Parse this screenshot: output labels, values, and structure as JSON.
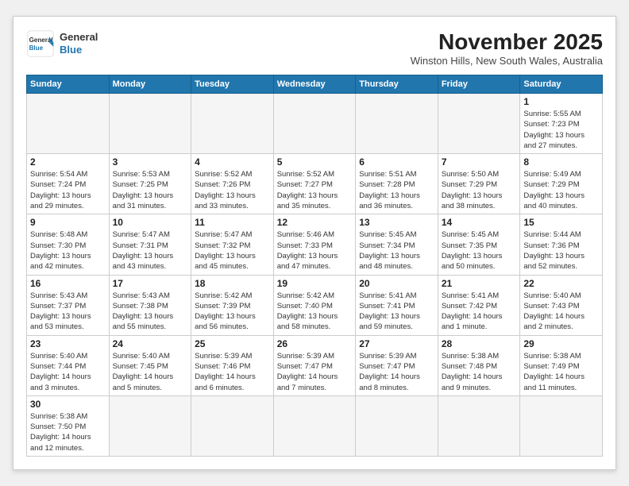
{
  "header": {
    "logo_general": "General",
    "logo_blue": "Blue",
    "month_title": "November 2025",
    "subtitle": "Winston Hills, New South Wales, Australia"
  },
  "days_of_week": [
    "Sunday",
    "Monday",
    "Tuesday",
    "Wednesday",
    "Thursday",
    "Friday",
    "Saturday"
  ],
  "weeks": [
    [
      {
        "day": "",
        "info": ""
      },
      {
        "day": "",
        "info": ""
      },
      {
        "day": "",
        "info": ""
      },
      {
        "day": "",
        "info": ""
      },
      {
        "day": "",
        "info": ""
      },
      {
        "day": "",
        "info": ""
      },
      {
        "day": "1",
        "info": "Sunrise: 5:55 AM\nSunset: 7:23 PM\nDaylight: 13 hours\nand 27 minutes."
      }
    ],
    [
      {
        "day": "2",
        "info": "Sunrise: 5:54 AM\nSunset: 7:24 PM\nDaylight: 13 hours\nand 29 minutes."
      },
      {
        "day": "3",
        "info": "Sunrise: 5:53 AM\nSunset: 7:25 PM\nDaylight: 13 hours\nand 31 minutes."
      },
      {
        "day": "4",
        "info": "Sunrise: 5:52 AM\nSunset: 7:26 PM\nDaylight: 13 hours\nand 33 minutes."
      },
      {
        "day": "5",
        "info": "Sunrise: 5:52 AM\nSunset: 7:27 PM\nDaylight: 13 hours\nand 35 minutes."
      },
      {
        "day": "6",
        "info": "Sunrise: 5:51 AM\nSunset: 7:28 PM\nDaylight: 13 hours\nand 36 minutes."
      },
      {
        "day": "7",
        "info": "Sunrise: 5:50 AM\nSunset: 7:29 PM\nDaylight: 13 hours\nand 38 minutes."
      },
      {
        "day": "8",
        "info": "Sunrise: 5:49 AM\nSunset: 7:29 PM\nDaylight: 13 hours\nand 40 minutes."
      }
    ],
    [
      {
        "day": "9",
        "info": "Sunrise: 5:48 AM\nSunset: 7:30 PM\nDaylight: 13 hours\nand 42 minutes."
      },
      {
        "day": "10",
        "info": "Sunrise: 5:47 AM\nSunset: 7:31 PM\nDaylight: 13 hours\nand 43 minutes."
      },
      {
        "day": "11",
        "info": "Sunrise: 5:47 AM\nSunset: 7:32 PM\nDaylight: 13 hours\nand 45 minutes."
      },
      {
        "day": "12",
        "info": "Sunrise: 5:46 AM\nSunset: 7:33 PM\nDaylight: 13 hours\nand 47 minutes."
      },
      {
        "day": "13",
        "info": "Sunrise: 5:45 AM\nSunset: 7:34 PM\nDaylight: 13 hours\nand 48 minutes."
      },
      {
        "day": "14",
        "info": "Sunrise: 5:45 AM\nSunset: 7:35 PM\nDaylight: 13 hours\nand 50 minutes."
      },
      {
        "day": "15",
        "info": "Sunrise: 5:44 AM\nSunset: 7:36 PM\nDaylight: 13 hours\nand 52 minutes."
      }
    ],
    [
      {
        "day": "16",
        "info": "Sunrise: 5:43 AM\nSunset: 7:37 PM\nDaylight: 13 hours\nand 53 minutes."
      },
      {
        "day": "17",
        "info": "Sunrise: 5:43 AM\nSunset: 7:38 PM\nDaylight: 13 hours\nand 55 minutes."
      },
      {
        "day": "18",
        "info": "Sunrise: 5:42 AM\nSunset: 7:39 PM\nDaylight: 13 hours\nand 56 minutes."
      },
      {
        "day": "19",
        "info": "Sunrise: 5:42 AM\nSunset: 7:40 PM\nDaylight: 13 hours\nand 58 minutes."
      },
      {
        "day": "20",
        "info": "Sunrise: 5:41 AM\nSunset: 7:41 PM\nDaylight: 13 hours\nand 59 minutes."
      },
      {
        "day": "21",
        "info": "Sunrise: 5:41 AM\nSunset: 7:42 PM\nDaylight: 14 hours\nand 1 minute."
      },
      {
        "day": "22",
        "info": "Sunrise: 5:40 AM\nSunset: 7:43 PM\nDaylight: 14 hours\nand 2 minutes."
      }
    ],
    [
      {
        "day": "23",
        "info": "Sunrise: 5:40 AM\nSunset: 7:44 PM\nDaylight: 14 hours\nand 3 minutes."
      },
      {
        "day": "24",
        "info": "Sunrise: 5:40 AM\nSunset: 7:45 PM\nDaylight: 14 hours\nand 5 minutes."
      },
      {
        "day": "25",
        "info": "Sunrise: 5:39 AM\nSunset: 7:46 PM\nDaylight: 14 hours\nand 6 minutes."
      },
      {
        "day": "26",
        "info": "Sunrise: 5:39 AM\nSunset: 7:47 PM\nDaylight: 14 hours\nand 7 minutes."
      },
      {
        "day": "27",
        "info": "Sunrise: 5:39 AM\nSunset: 7:47 PM\nDaylight: 14 hours\nand 8 minutes."
      },
      {
        "day": "28",
        "info": "Sunrise: 5:38 AM\nSunset: 7:48 PM\nDaylight: 14 hours\nand 9 minutes."
      },
      {
        "day": "29",
        "info": "Sunrise: 5:38 AM\nSunset: 7:49 PM\nDaylight: 14 hours\nand 11 minutes."
      }
    ],
    [
      {
        "day": "30",
        "info": "Sunrise: 5:38 AM\nSunset: 7:50 PM\nDaylight: 14 hours\nand 12 minutes."
      },
      {
        "day": "",
        "info": ""
      },
      {
        "day": "",
        "info": ""
      },
      {
        "day": "",
        "info": ""
      },
      {
        "day": "",
        "info": ""
      },
      {
        "day": "",
        "info": ""
      },
      {
        "day": "",
        "info": ""
      }
    ]
  ]
}
